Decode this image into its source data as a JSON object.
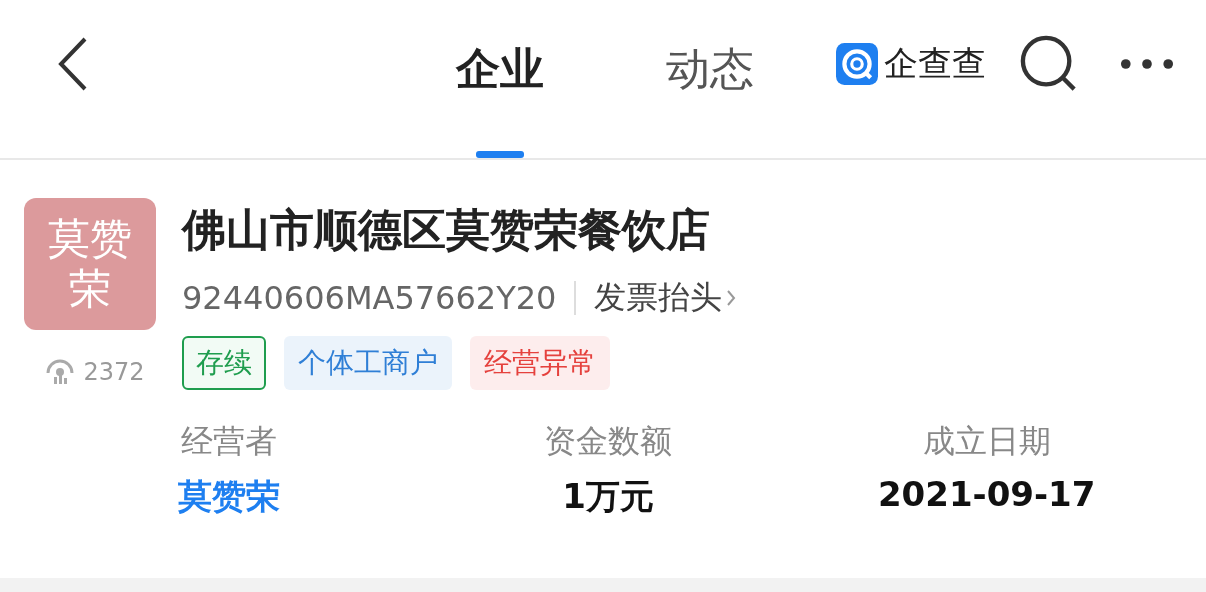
{
  "nav": {
    "tabs": [
      {
        "label": "企业",
        "selected": true
      },
      {
        "label": "动态",
        "selected": false
      }
    ],
    "brand": "企查查"
  },
  "company": {
    "avatar_text": "莫赞荣",
    "views": "2372",
    "name": "佛山市顺德区莫赞荣餐饮店",
    "credit_code": "92440606MA57662Y20",
    "invoice_link": "发票抬头",
    "tags": [
      {
        "label": "存续",
        "kind": "outline",
        "color": "#1f9d4e"
      },
      {
        "label": "个体工商户",
        "kind": "fill",
        "color": "#2f7fd6"
      },
      {
        "label": "经营异常",
        "kind": "fill",
        "color": "#e5413d"
      }
    ]
  },
  "facts": [
    {
      "label": "经营者",
      "value": "莫赞荣",
      "kind": "link"
    },
    {
      "label": "资金数额",
      "value": "1万元",
      "kind": "text"
    },
    {
      "label": "成立日期",
      "value": "2021-09-17",
      "kind": "text"
    }
  ]
}
